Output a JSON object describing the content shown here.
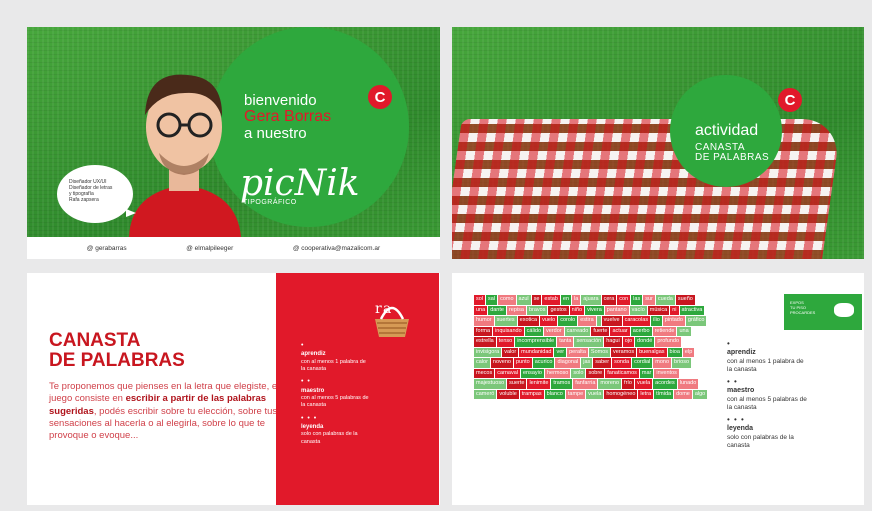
{
  "card1": {
    "welcome": "bienvenido",
    "name": "Gera Borras",
    "a_nuestro": "a nuestro",
    "picnik": "picNik",
    "tipografico": "TIPOGRÁFICO",
    "bubble_lines": [
      "Diseñador UX/UI",
      "Diseñador de letras",
      "y tipografía",
      "Rafa zapsera"
    ],
    "footer": [
      "@ gerabarras",
      "@ elmalpileeger",
      "@ cooperativa@mazalicom.ar"
    ]
  },
  "card2": {
    "title": "actividad",
    "subtitle1": "CANASTA",
    "subtitle2": "DE PALABRAS"
  },
  "card3": {
    "title1": "CANASTA",
    "title2": "DE PALABRAS",
    "body_pre": "Te proponemos que pienses en la letra que elegiste, el juego consiste en ",
    "body_bold": "escribir a partir de las palabras sugeridas",
    "body_post": ", podés escribir sobre tu elección, sobre tus sensaciones al hacerla o al elegirla, sobre lo que te provoque o evoque...",
    "rules": [
      {
        "dots": "•",
        "title": "aprendiz",
        "text": "con al menos 1 palabra de la canasta"
      },
      {
        "dots": "• •",
        "title": "maestro",
        "text": "con al menos 5 palabras de la canasta"
      },
      {
        "dots": "• • •",
        "title": "leyenda",
        "text": "solo con palabras de la canasta"
      }
    ]
  },
  "card4": {
    "words": [
      "sol",
      "sal",
      "como",
      "azul",
      "se",
      "estab",
      "en",
      "la",
      "ajuara",
      "cera",
      "con",
      "las",
      "sur",
      "cueda",
      "sueño",
      "una",
      "dante",
      "repisa",
      "bravos",
      "gestos",
      "niño",
      "vivera",
      "pantano",
      "vacío",
      "música",
      "ni",
      "atractiva",
      "humor",
      "suertes",
      "exotica",
      "vuelo",
      "corolo",
      "estira",
      "",
      "vuelve",
      "caracolas",
      "ilio",
      "pintado",
      "gráfico",
      "forma",
      "inquisando",
      "cálido",
      "verdor",
      "carreado",
      "fuerte",
      "actuar",
      "acerbo",
      "retiende",
      "una",
      "estrella",
      "tenso",
      "incomprensible",
      "tanta",
      "sensación",
      "hagui",
      "ojo",
      "dondé",
      "profundo",
      "invisigora",
      "valor",
      "mundanidad",
      "ver",
      "peralta",
      "Somos",
      "veramos",
      "buenalgas",
      "bioa",
      "elp",
      "calor",
      "noveno",
      "punto",
      "acurico",
      "diagonal",
      "jas",
      "saber",
      "sonda",
      "cordial",
      "mono",
      "brioso",
      "mecos",
      "carnaval",
      "ensayio",
      "hermoso",
      "solo",
      "sobre",
      "fanaticamos",
      "mar",
      "inventos",
      "majestuoso",
      "suerte",
      "lenimite",
      "tramos",
      "fanfarria",
      "moreno",
      "frío",
      "vuela",
      "acordes",
      "lunado",
      "cameró",
      "voluble",
      "trampas",
      "blanco",
      "tampe",
      "vuela",
      "homogéneo",
      "letra",
      "tímida",
      "dome",
      "algo"
    ],
    "legend": [
      {
        "dots": "•",
        "title": "aprendiz",
        "text": "con al menos 1 palabra de la canasta"
      },
      {
        "dots": "• •",
        "title": "maestro",
        "text": "con al menos 5 palabras de la canasta"
      },
      {
        "dots": "• • •",
        "title": "leyenda",
        "text": "solo con palabras de la canasta"
      }
    ],
    "greenbox": [
      "EXPOS",
      "TU PISO",
      "PROCARDES"
    ]
  },
  "colors": {
    "red": "#e1192a",
    "green": "#2ea83d"
  }
}
